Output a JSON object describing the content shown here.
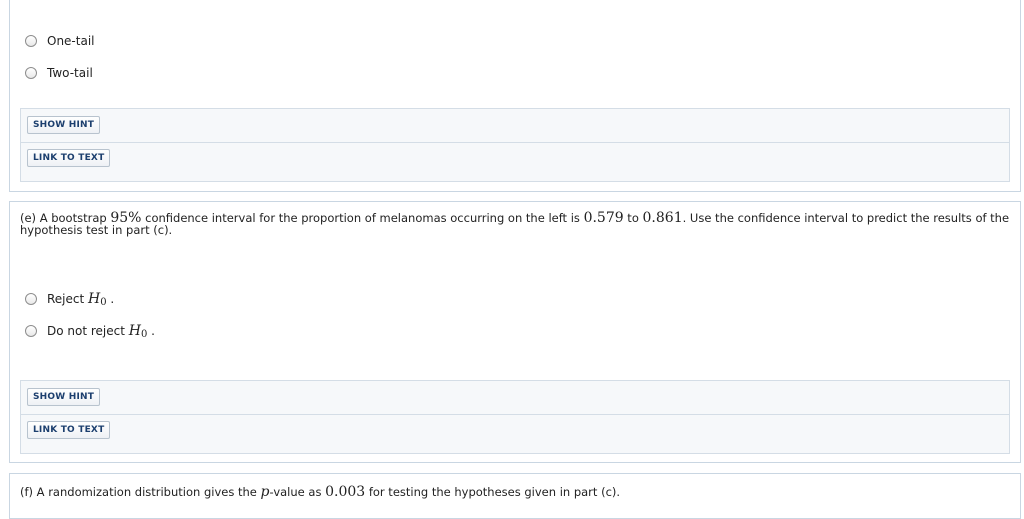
{
  "part_d": {
    "options": [
      "One-tail",
      "Two-tail"
    ],
    "show_hint": "SHOW HINT",
    "link_to_text": "LINK TO TEXT"
  },
  "part_e": {
    "q_a": "(e) A bootstrap ",
    "q_pct": "95%",
    "q_b": " confidence interval for the proportion of melanomas occurring on the left is ",
    "q_low": "0.579",
    "q_c": " to ",
    "q_high": "0.861",
    "q_d": ". Use the confidence interval to predict the results of the hypothesis test in part (c).",
    "opt1_text": "Reject ",
    "opt2_text": "Do not reject ",
    "h_var": "H",
    "h_sub": "0",
    "opt_suffix": " .",
    "show_hint": "SHOW HINT",
    "link_to_text": "LINK TO TEXT"
  },
  "part_f": {
    "q_a": "(f) A randomization distribution gives the ",
    "p_var": "p",
    "q_b": "-value as ",
    "q_val": "0.003",
    "q_c": " for testing the hypotheses given in part (c)."
  }
}
